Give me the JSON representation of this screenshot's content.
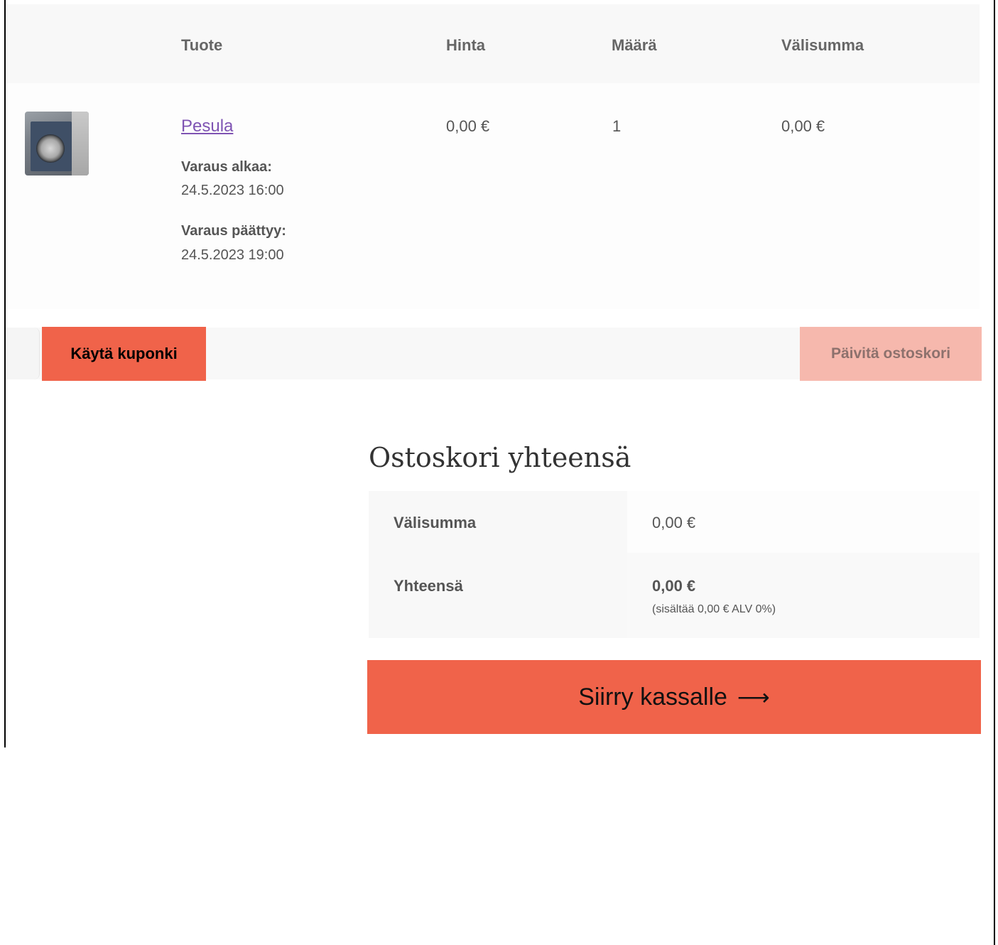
{
  "cart_table": {
    "headers": {
      "product": "Tuote",
      "price": "Hinta",
      "quantity": "Määrä",
      "subtotal": "Välisumma"
    },
    "items": [
      {
        "name": "Pesula",
        "thumbnail_icon": "washing-machine-photo",
        "price": "0,00 €",
        "quantity": "1",
        "subtotal": "0,00 €",
        "meta": [
          {
            "label": "Varaus alkaa:",
            "value": "24.5.2023 16:00"
          },
          {
            "label": "Varaus päättyy:",
            "value": "24.5.2023 19:00"
          }
        ]
      }
    ]
  },
  "actions": {
    "coupon_placeholder": "",
    "apply_coupon_label": "Käytä kuponki",
    "update_cart_label": "Päivitä ostoskori"
  },
  "cart_totals": {
    "title": "Ostoskori yhteensä",
    "subtotal_label": "Välisumma",
    "subtotal_value": "0,00 €",
    "total_label": "Yhteensä",
    "total_value": "0,00 €",
    "tax_note": "(sisältää 0,00 € ALV 0%)"
  },
  "checkout": {
    "label": "Siirry kassalle",
    "icon": "arrow-right-icon"
  },
  "colors": {
    "accent": "#f0634a",
    "accent_disabled": "#f6ada0",
    "link": "#7f54b3",
    "table_bg": "#f8f8f8"
  }
}
